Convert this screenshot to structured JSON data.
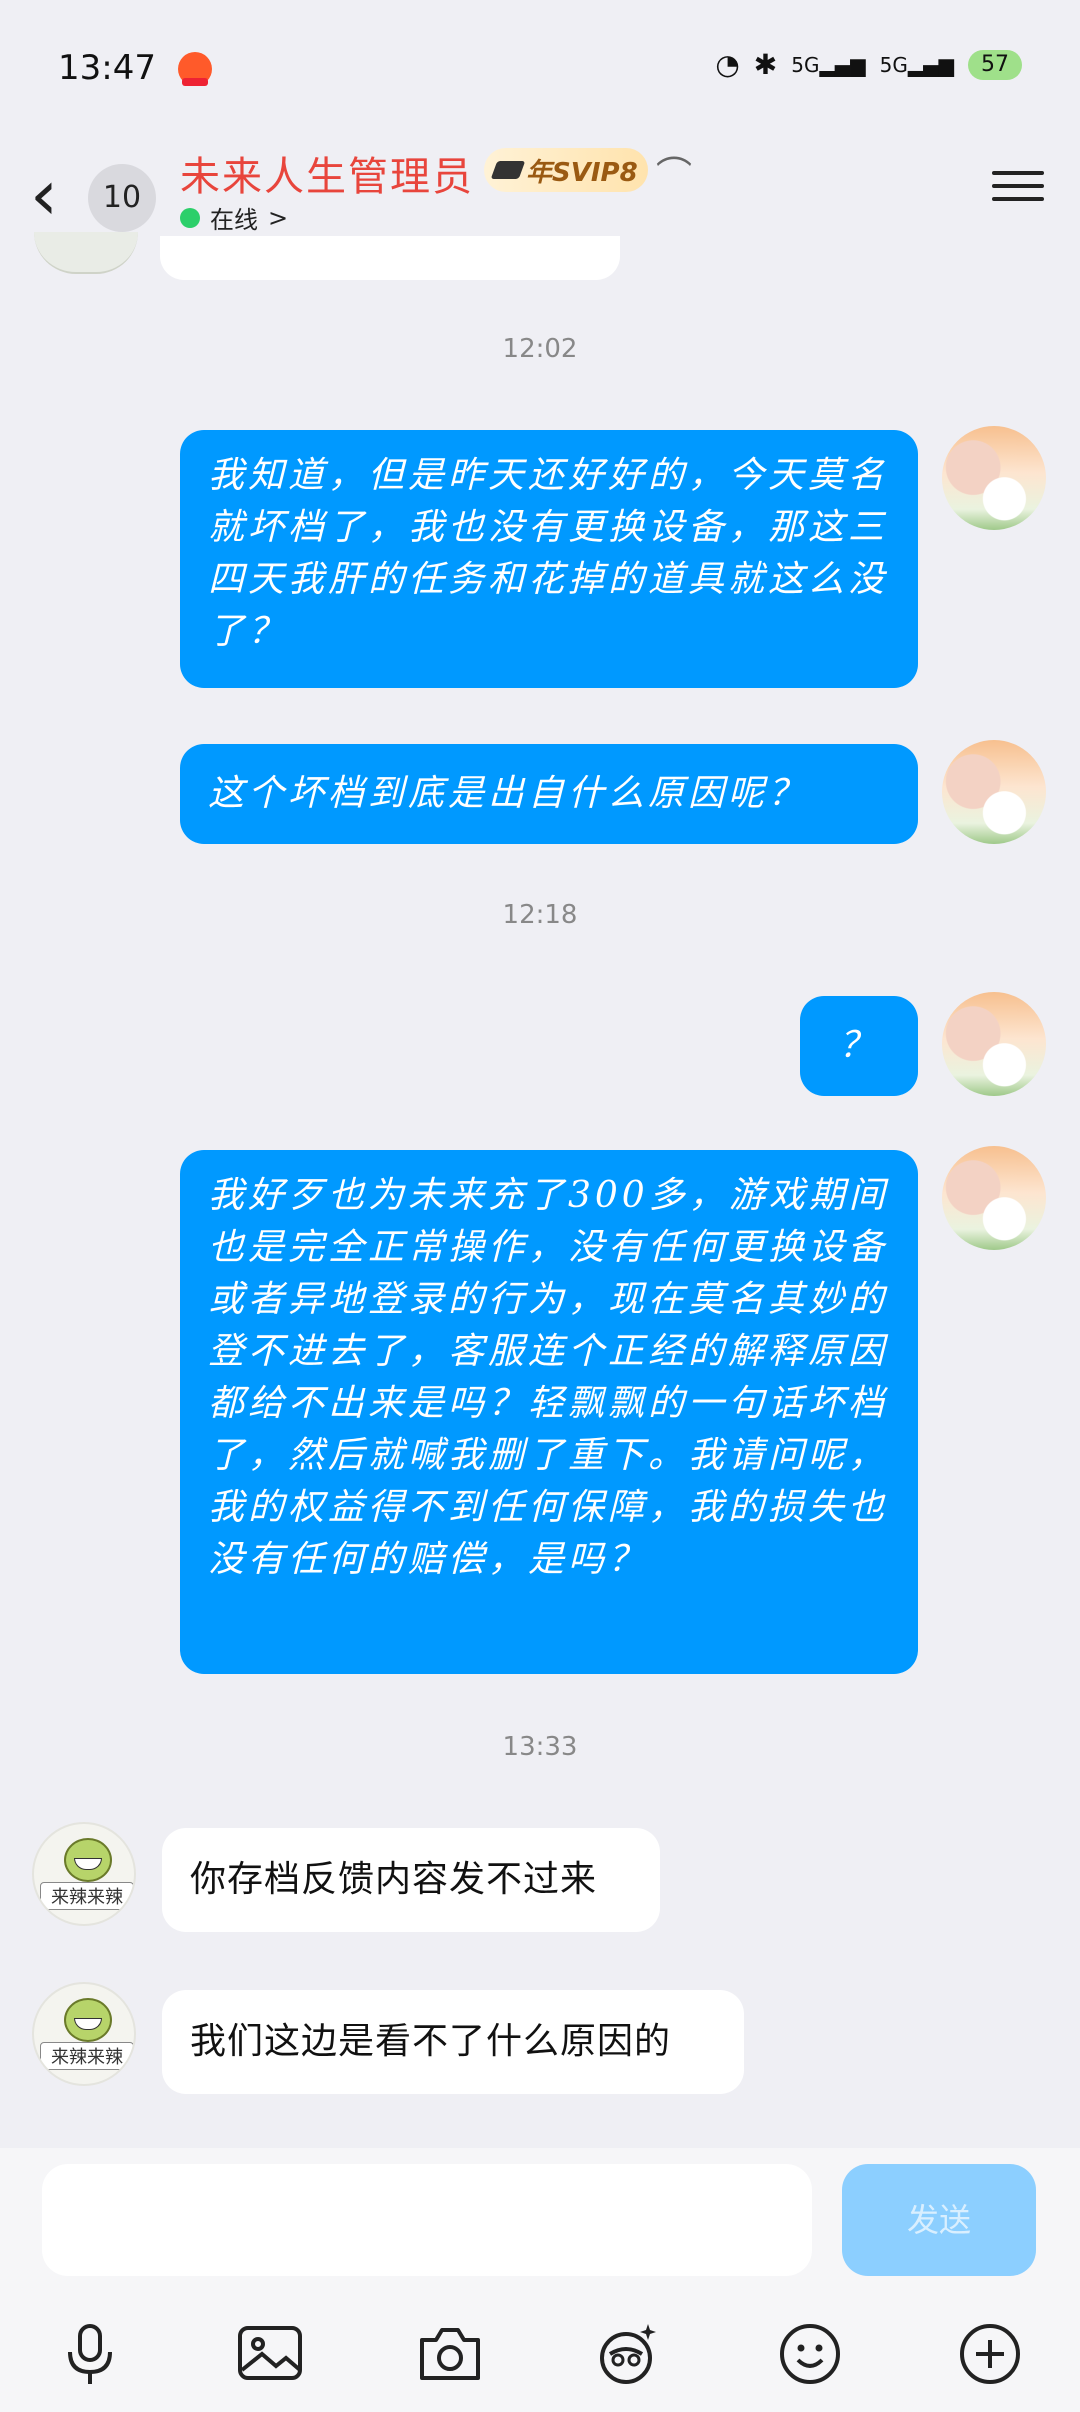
{
  "status_bar": {
    "time": "13:47",
    "signal_1": "5G",
    "signal_2": "5G",
    "battery": "57"
  },
  "header": {
    "back_count": "10",
    "title": "未来人生管理员",
    "vip_label": "年SVIP8",
    "status": "在线",
    "chevron": ">"
  },
  "messages": [
    {
      "type": "timestamp",
      "text": "12:02"
    },
    {
      "type": "outgoing",
      "text": "我知道，但是昨天还好好的，今天莫名就坏档了，我也没有更换设备，那这三四天我肝的任务和花掉的道具就这么没了？"
    },
    {
      "type": "outgoing",
      "text": "这个坏档到底是出自什么原因呢？"
    },
    {
      "type": "timestamp",
      "text": "12:18"
    },
    {
      "type": "outgoing",
      "text": "？"
    },
    {
      "type": "outgoing",
      "text": "我好歹也为未来充了300多，游戏期间也是完全正常操作，没有任何更换设备或者异地登录的行为，现在莫名其妙的登不进去了，客服连个正经的解释原因都给不出来是吗？轻飘飘的一句话坏档了，然后就喊我删了重下。我请问呢，我的权益得不到任何保障，我的损失也没有任何的赔偿，是吗？"
    },
    {
      "type": "timestamp",
      "text": "13:33"
    },
    {
      "type": "incoming",
      "text": "你存档反馈内容发不过来"
    },
    {
      "type": "incoming",
      "text": "我们这边是看不了什么原因的"
    }
  ],
  "avatar_label": "来辣来辣",
  "input": {
    "placeholder": "",
    "send_label": "发送"
  },
  "toolbar": [
    "microphone-icon",
    "image-icon",
    "camera-icon",
    "red-packet-icon",
    "emoji-icon",
    "plus-icon"
  ],
  "colors": {
    "outgoing_bubble": "#0099ff",
    "incoming_bubble": "#ffffff",
    "title": "#e8453c",
    "background": "#efeff4",
    "send_disabled": "#8ccfff"
  }
}
